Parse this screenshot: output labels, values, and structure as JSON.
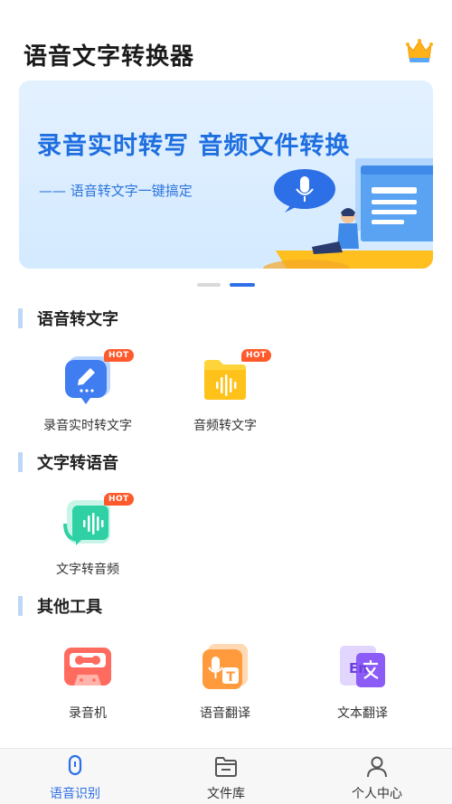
{
  "app": {
    "title": "语音文字转换器",
    "crown_icon": "crown-icon"
  },
  "banner": {
    "headline": "录音实时转写  音频文件转换",
    "subtitle": "—— 语音转文字一键搞定",
    "dots_total": 2,
    "active_dot": 2
  },
  "sections": [
    {
      "title": "语音转文字",
      "tools": [
        {
          "label": "录音实时转文字",
          "icon": "edit-chat-icon",
          "hot": "HOT"
        },
        {
          "label": "音频转文字",
          "icon": "audio-folder-icon",
          "hot": "HOT"
        }
      ]
    },
    {
      "title": "文字转语音",
      "tools": [
        {
          "label": "文字转音频",
          "icon": "text-to-audio-icon",
          "hot": "HOT"
        }
      ]
    },
    {
      "title": "其他工具",
      "tools": [
        {
          "label": "录音机",
          "icon": "cassette-icon"
        },
        {
          "label": "语音翻译",
          "icon": "voice-translate-icon"
        },
        {
          "label": "文本翻译",
          "icon": "text-translate-icon"
        }
      ]
    }
  ],
  "tabbar": {
    "items": [
      {
        "label": "语音识别",
        "icon": "microphone-icon",
        "active": true
      },
      {
        "label": "文件库",
        "icon": "folder-icon",
        "active": false
      },
      {
        "label": "个人中心",
        "icon": "user-icon",
        "active": false
      }
    ]
  },
  "colors": {
    "accent": "#2d6fe6",
    "hot_badge": "#ff5a2c",
    "section_bar": "#bcd8f6",
    "banner_text": "#1f6fe0"
  }
}
